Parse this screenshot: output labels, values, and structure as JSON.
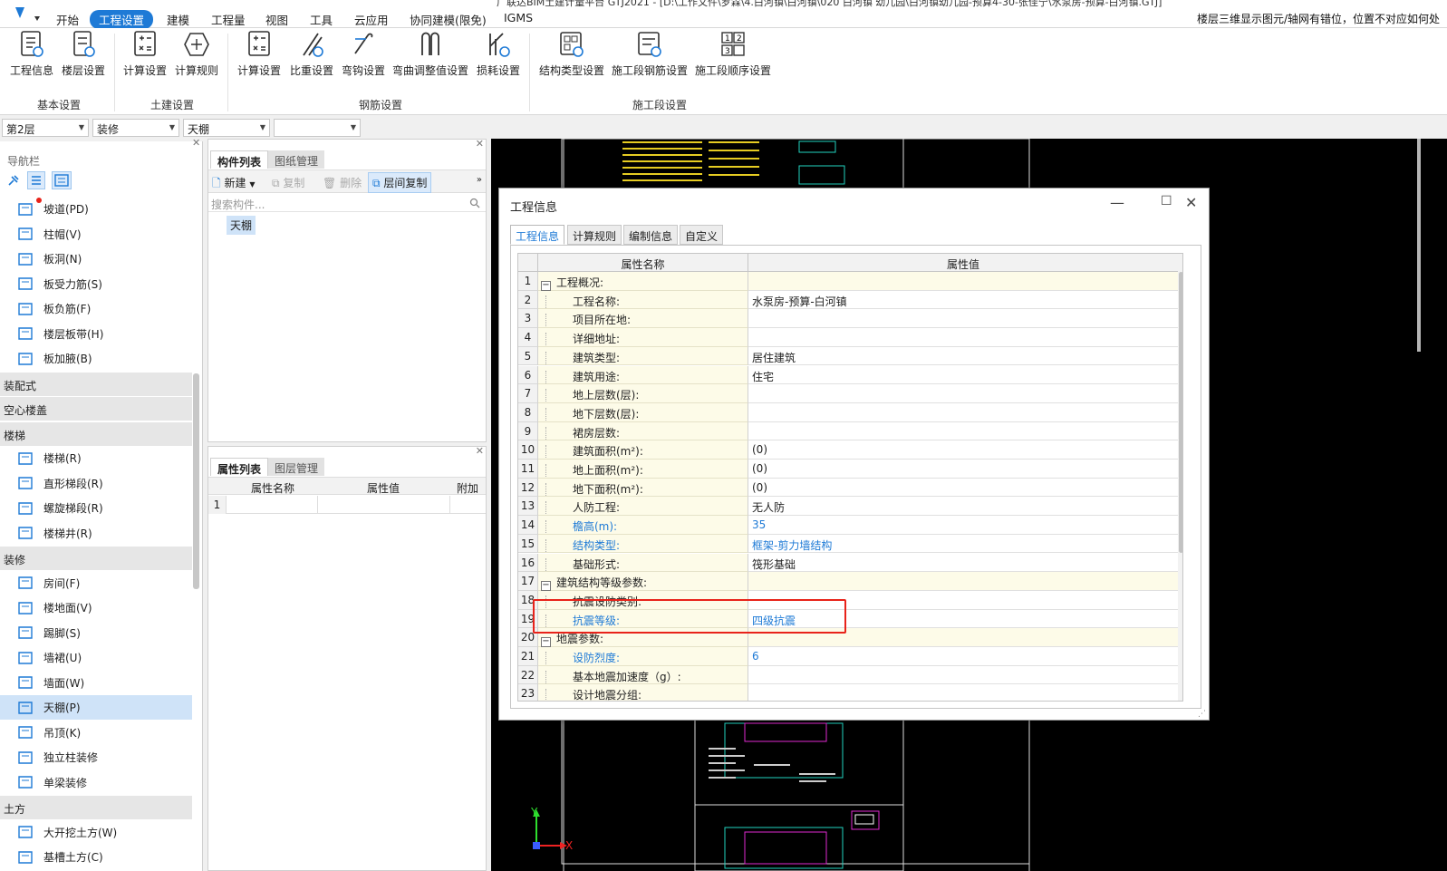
{
  "window": {
    "title_fragment": "广联达BIM土建计量平台 GTJ2021 - [D:\\工作文件\\罗霖\\4.白河镇\\白河镇\\020 白河镇 幼儿园\\白河镇幼儿园-预算4-30-张佳宁\\水泵房-预算-白河镇.GTJ]",
    "hint": "楼层三维显示图元/轴网有错位，位置不对应如何处"
  },
  "menu": [
    "开始",
    "工程设置",
    "建模",
    "工程量",
    "视图",
    "工具",
    "云应用",
    "协同建模(限免)",
    "IGMS"
  ],
  "menu_active": "工程设置",
  "ribbon": {
    "buttons": [
      "工程信息",
      "楼层设置",
      "计算设置",
      "计算规则",
      "计算设置",
      "比重设置",
      "弯钩设置",
      "弯曲调整值设置",
      "损耗设置",
      "结构类型设置",
      "施工段钢筋设置",
      "施工段顺序设置"
    ],
    "groups": [
      "基本设置",
      "土建设置",
      "钢筋设置",
      "施工段设置"
    ]
  },
  "selectors": [
    "第2层",
    "装修",
    "天棚",
    ""
  ],
  "nav": {
    "title": "导航栏",
    "items_a": [
      "坡道(PD)",
      "柱帽(V)",
      "板洞(N)",
      "板受力筋(S)",
      "板负筋(F)",
      "楼层板带(H)",
      "板加腋(B)"
    ],
    "categories": [
      "装配式",
      "空心楼盖",
      "楼梯",
      "装修",
      "土方"
    ],
    "items_stair": [
      "楼梯(R)",
      "直形梯段(R)",
      "螺旋梯段(R)",
      "楼梯井(R)"
    ],
    "items_decor": [
      "房间(F)",
      "楼地面(V)",
      "踢脚(S)",
      "墙裙(U)",
      "墙面(W)",
      "天棚(P)",
      "吊顶(K)",
      "独立柱装修",
      "单梁装修"
    ],
    "items_earth": [
      "大开挖土方(W)",
      "基槽土方(C)"
    ],
    "selected": "天棚(P)"
  },
  "component_list": {
    "tabs": [
      "构件列表",
      "图纸管理"
    ],
    "toolbar": [
      "新建",
      "复制",
      "删除",
      "层间复制"
    ],
    "search_placeholder": "搜索构件...",
    "items": [
      "天棚"
    ]
  },
  "property_list": {
    "tabs": [
      "属性列表",
      "图层管理"
    ],
    "columns": [
      "属性名称",
      "属性值",
      "附加"
    ],
    "rows": [
      "1"
    ]
  },
  "dialog": {
    "title": "工程信息",
    "tabs": [
      "工程信息",
      "计算规则",
      "编制信息",
      "自定义"
    ],
    "columns": [
      "属性名称",
      "属性值"
    ],
    "rows": [
      {
        "n": "1",
        "name": "工程概况:",
        "value": "",
        "group": true
      },
      {
        "n": "2",
        "name": "工程名称:",
        "value": "水泵房-预算-白河镇"
      },
      {
        "n": "3",
        "name": "项目所在地:",
        "value": ""
      },
      {
        "n": "4",
        "name": "详细地址:",
        "value": ""
      },
      {
        "n": "5",
        "name": "建筑类型:",
        "value": "居住建筑"
      },
      {
        "n": "6",
        "name": "建筑用途:",
        "value": "住宅"
      },
      {
        "n": "7",
        "name": "地上层数(层):",
        "value": ""
      },
      {
        "n": "8",
        "name": "地下层数(层):",
        "value": ""
      },
      {
        "n": "9",
        "name": "裙房层数:",
        "value": ""
      },
      {
        "n": "10",
        "name": "建筑面积(m²):",
        "value": "(0)"
      },
      {
        "n": "11",
        "name": "地上面积(m²):",
        "value": "(0)"
      },
      {
        "n": "12",
        "name": "地下面积(m²):",
        "value": "(0)"
      },
      {
        "n": "13",
        "name": "人防工程:",
        "value": "无人防"
      },
      {
        "n": "14",
        "name": "檐高(m):",
        "value": "35",
        "blue": true
      },
      {
        "n": "15",
        "name": "结构类型:",
        "value": "框架-剪力墙结构",
        "blue": true
      },
      {
        "n": "16",
        "name": "基础形式:",
        "value": "筏形基础"
      },
      {
        "n": "17",
        "name": "建筑结构等级参数:",
        "value": "",
        "group": true
      },
      {
        "n": "18",
        "name": "抗震设防类别:",
        "value": ""
      },
      {
        "n": "19",
        "name": "抗震等级:",
        "value": "四级抗震",
        "blue": true
      },
      {
        "n": "20",
        "name": "地震参数:",
        "value": "",
        "group": true
      },
      {
        "n": "21",
        "name": "设防烈度:",
        "value": "6",
        "blue": true
      },
      {
        "n": "22",
        "name": "基本地震加速度（g）:",
        "value": ""
      },
      {
        "n": "23",
        "name": "设计地震分组:",
        "value": ""
      }
    ]
  },
  "axes": {
    "y": "Y",
    "x": "X"
  }
}
